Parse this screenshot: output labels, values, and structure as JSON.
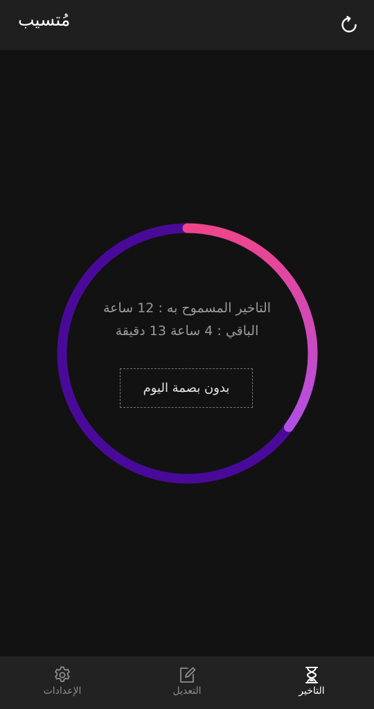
{
  "header": {
    "title": "مُتسيب",
    "refresh_icon": "refresh-icon"
  },
  "status": {
    "allowed_delay": "التاخير المسموح به : 12 ساعة",
    "remaining": "الباقي : 4 ساعة 13 دقيقة",
    "fingerprint_button": "بدون بصمة اليوم",
    "progress": 0.35
  },
  "colors": {
    "background": "#121212",
    "header": "#1f1f1f",
    "ring_track": "#4a0a99",
    "ring_start": "#f0458a",
    "ring_end": "#b04fe6",
    "nav": "#222222"
  },
  "nav": {
    "items": [
      {
        "label": "التاخير",
        "icon": "hourglass-icon",
        "active": true
      },
      {
        "label": "التعديل",
        "icon": "edit-icon",
        "active": false
      },
      {
        "label": "الإعدادات",
        "icon": "gear-icon",
        "active": false
      }
    ]
  }
}
